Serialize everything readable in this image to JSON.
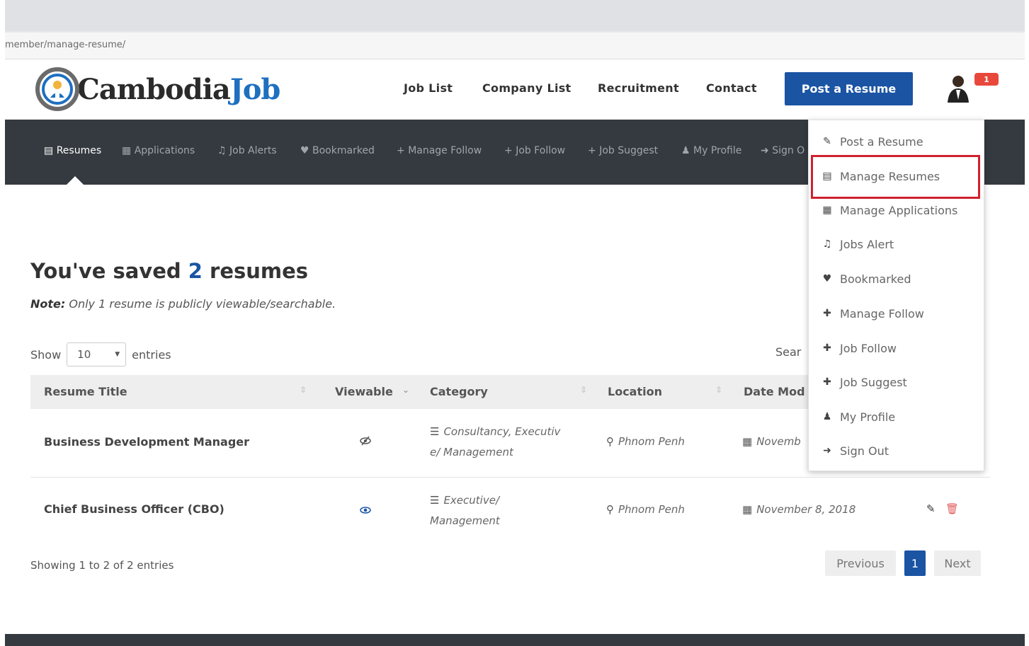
{
  "browser": {
    "url": "member/manage-resume/"
  },
  "header": {
    "logo": {
      "text_main": "Cambodia",
      "text_accent": "Job"
    },
    "nav": [
      "Job List",
      "Company List",
      "Recruitment",
      "Contact"
    ],
    "post_button": "Post a Resume",
    "notification_badge": "1"
  },
  "subnav": {
    "items": [
      {
        "icon": "file-icon",
        "label": "Resumes",
        "active": true
      },
      {
        "icon": "list-icon",
        "label": "Applications"
      },
      {
        "icon": "bell-icon",
        "label": "Job Alerts"
      },
      {
        "icon": "heart-icon",
        "label": "Bookmarked"
      },
      {
        "icon": "plus-icon",
        "label": "Manage Follow"
      },
      {
        "icon": "plus-icon",
        "label": "Job Follow"
      },
      {
        "icon": "plus-icon",
        "label": "Job Suggest"
      },
      {
        "icon": "user-icon",
        "label": "My Profile"
      },
      {
        "icon": "sign-out-icon",
        "label": "Sign O"
      }
    ]
  },
  "main": {
    "title_prefix": "You've saved",
    "count": "2",
    "title_suffix": "resumes",
    "note_label": "Note:",
    "note_text": "Only 1 resume is publicly viewable/searchable.",
    "show_label": "Show",
    "entries_value": "10",
    "entries_label": "entries",
    "search_label": "Sear"
  },
  "table": {
    "headers": [
      "Resume Title",
      "Viewable",
      "Category",
      "Location",
      "Date Mod"
    ],
    "rows": [
      {
        "title": "Business Development Manager",
        "viewable_icon": "eye-slash-icon",
        "category_line1": "Consultancy, Executiv",
        "category_line2": "e/ Management",
        "location": "Phnom Penh",
        "date": "Novemb"
      },
      {
        "title": "Chief Business Officer (CBO)",
        "viewable_icon": "eye-icon",
        "category_line1": "Executive/",
        "category_line2": "Management",
        "location": "Phnom Penh",
        "date": "November 8, 2018"
      }
    ]
  },
  "pagination": {
    "info": "Showing 1 to 2 of 2 entries",
    "previous": "Previous",
    "page": "1",
    "next": "Next"
  },
  "dropdown": {
    "items": [
      {
        "icon": "edit-icon",
        "label": "Post a Resume"
      },
      {
        "icon": "file-icon",
        "label": "Manage Resumes",
        "highlighted": true
      },
      {
        "icon": "list-icon",
        "label": "Manage Applications"
      },
      {
        "icon": "bell-icon",
        "label": "Jobs Alert"
      },
      {
        "icon": "heart-icon",
        "label": "Bookmarked"
      },
      {
        "icon": "plus-icon",
        "label": "Manage Follow"
      },
      {
        "icon": "plus-icon",
        "label": "Job Follow"
      },
      {
        "icon": "plus-icon",
        "label": "Job Suggest"
      },
      {
        "icon": "user-icon",
        "label": "My Profile"
      },
      {
        "icon": "sign-out-icon",
        "label": "Sign Out"
      }
    ]
  },
  "colors": {
    "brand_blue": "#1a54a3",
    "dark_nav": "#343a40",
    "highlight_red": "#d0202e",
    "badge_red": "#e8483c"
  }
}
